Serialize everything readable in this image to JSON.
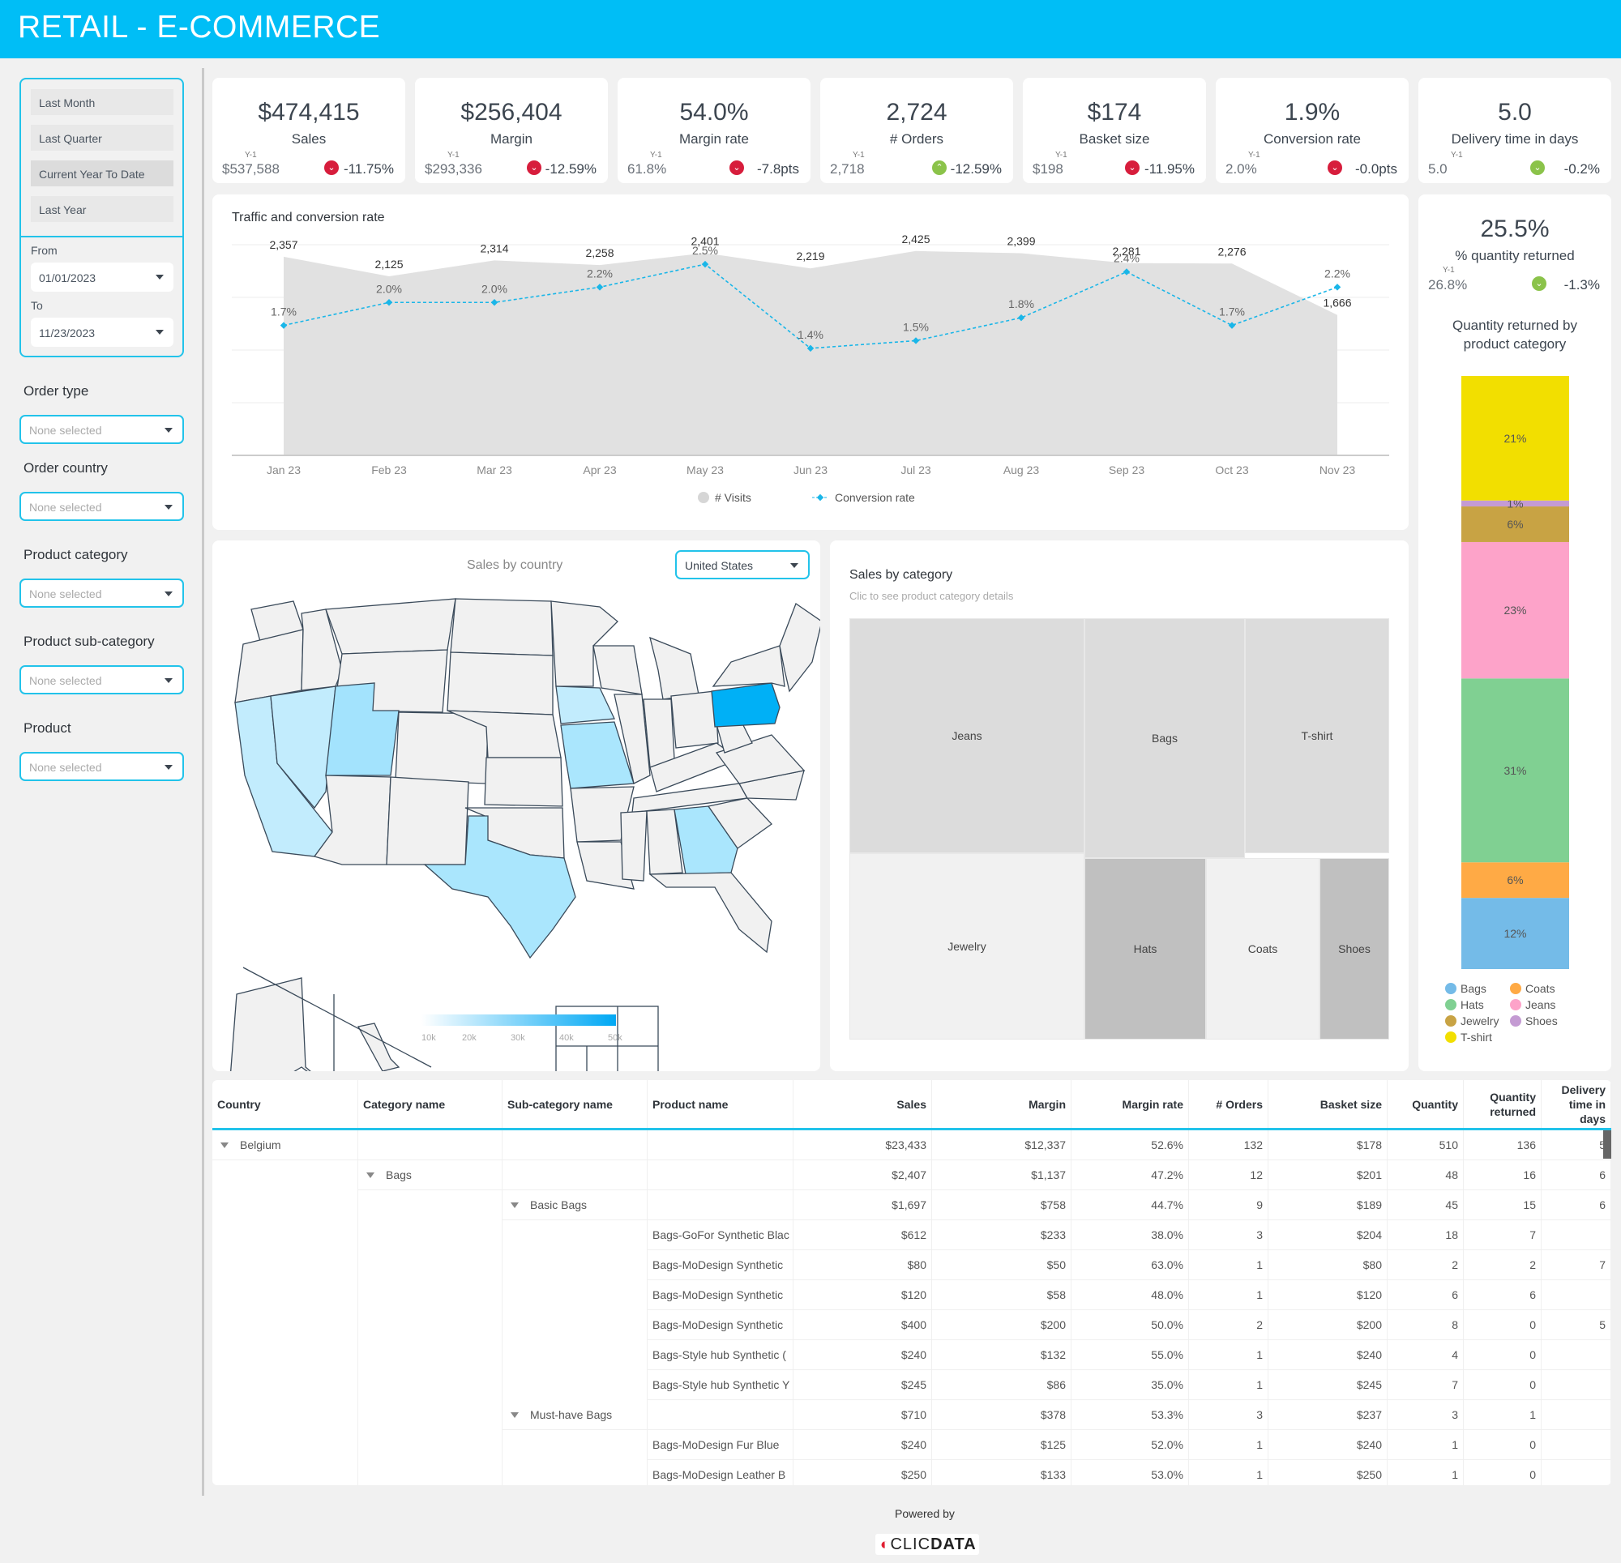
{
  "header": {
    "title": "RETAIL - E-COMMERCE"
  },
  "date_filter": {
    "presets": [
      "Last Month",
      "Last Quarter",
      "Current Year To Date",
      "Last Year"
    ],
    "active_preset": "Current Year To Date",
    "from_label": "From",
    "from_value": "01/01/2023",
    "to_label": "To",
    "to_value": "11/23/2023"
  },
  "filters": [
    {
      "label": "Order type",
      "placeholder": "None selected"
    },
    {
      "label": "Order country",
      "placeholder": "None selected"
    },
    {
      "label": "Product category",
      "placeholder": "None selected"
    },
    {
      "label": "Product sub-category",
      "placeholder": "None selected"
    },
    {
      "label": "Product",
      "placeholder": "None selected"
    }
  ],
  "kpis": [
    {
      "value": "$474,415",
      "name": "Sales",
      "y1_label": "Y-1",
      "prev": "$537,588",
      "delta": "-11.75%",
      "trend": "down",
      "status": "bad"
    },
    {
      "value": "$256,404",
      "name": "Margin",
      "y1_label": "Y-1",
      "prev": "$293,336",
      "delta": "-12.59%",
      "trend": "down",
      "status": "bad"
    },
    {
      "value": "54.0%",
      "name": "Margin rate",
      "y1_label": "Y-1",
      "prev": "61.8%",
      "delta": "-7.8pts",
      "trend": "down",
      "status": "bad"
    },
    {
      "value": "2,724",
      "name": "# Orders",
      "y1_label": "Y-1",
      "prev": "2,718",
      "delta": "-12.59%",
      "trend": "up",
      "status": "good"
    },
    {
      "value": "$174",
      "name": "Basket size",
      "y1_label": "Y-1",
      "prev": "$198",
      "delta": "-11.95%",
      "trend": "down",
      "status": "bad"
    },
    {
      "value": "1.9%",
      "name": "Conversion rate",
      "y1_label": "Y-1",
      "prev": "2.0%",
      "delta": "-0.0pts",
      "trend": "down",
      "status": "bad"
    },
    {
      "value": "5.0",
      "name": "Delivery time in days",
      "y1_label": "Y-1",
      "prev": "5.0",
      "delta": "-0.2%",
      "trend": "down",
      "status": "good"
    }
  ],
  "returns_kpi": {
    "value": "25.5%",
    "name": "% quantity returned",
    "y1_label": "Y-1",
    "prev": "26.8%",
    "delta": "-1.3%",
    "trend": "down",
    "status": "good",
    "chart_title": "Quantity returned by product category"
  },
  "colors": {
    "accent": "#00bef6",
    "bad": "#d71d3c",
    "good": "#8bc34a",
    "line": "#1ab6e8",
    "area": "#e1e1e1"
  },
  "map": {
    "title": "Sales by country",
    "country_select": "United States",
    "legend_ticks": [
      "10k",
      "20k",
      "30k",
      "40k",
      "50k"
    ]
  },
  "treemap": {
    "title": "Sales by category",
    "subtitle": "Clic to see product category details",
    "categories": [
      {
        "name": "Jeans"
      },
      {
        "name": "Bags"
      },
      {
        "name": "T-shirt"
      },
      {
        "name": "Jewelry"
      },
      {
        "name": "Hats"
      },
      {
        "name": "Coats"
      },
      {
        "name": "Shoes"
      }
    ]
  },
  "chart_data": [
    {
      "type": "area",
      "title": "Traffic and conversion rate",
      "categories": [
        "Jan 23",
        "Feb 23",
        "Mar 23",
        "Apr 23",
        "May 23",
        "Jun 23",
        "Jul 23",
        "Aug 23",
        "Sep 23",
        "Oct 23",
        "Nov 23"
      ],
      "series": [
        {
          "name": "# Visits",
          "type": "area",
          "values": [
            2357,
            2125,
            2314,
            2258,
            2401,
            2219,
            2425,
            2399,
            2281,
            2276,
            1666
          ],
          "labels": [
            "2,357",
            "2,125",
            "2,314",
            "2,258",
            "2,401",
            "2,219",
            "2,425",
            "2,399",
            "2,281",
            "2,276",
            "1,666"
          ]
        },
        {
          "name": "Conversion rate",
          "type": "line",
          "values": [
            1.7,
            2.0,
            2.0,
            2.2,
            2.5,
            1.4,
            1.5,
            1.8,
            2.4,
            1.7,
            2.2
          ],
          "labels": [
            "1.7%",
            "2.0%",
            "2.0%",
            "2.2%",
            "2.5%",
            "1.4%",
            "1.5%",
            "1.8%",
            "2.4%",
            "1.7%",
            "2.2%"
          ]
        }
      ],
      "legend": "bottom",
      "grid": true
    },
    {
      "type": "bar",
      "title": "Quantity returned by product category",
      "stacked": true,
      "series": [
        {
          "name": "Bags",
          "value": 12,
          "label": "12%",
          "color": "#74bbe8"
        },
        {
          "name": "Coats",
          "value": 6,
          "label": "6%",
          "color": "#ffaa45"
        },
        {
          "name": "Hats",
          "value": 31,
          "label": "31%",
          "color": "#80d092"
        },
        {
          "name": "Jeans",
          "value": 23,
          "label": "23%",
          "color": "#fda3c9"
        },
        {
          "name": "Jewelry",
          "value": 6,
          "label": "6%",
          "color": "#c8a344"
        },
        {
          "name": "Shoes",
          "value": 1,
          "label": "1%",
          "color": "#c49bd3"
        },
        {
          "name": "T-shirt",
          "value": 21,
          "label": "21%",
          "color": "#f2df00"
        }
      ],
      "legend_order": [
        "Bags",
        "Coats",
        "Hats",
        "Jeans",
        "Jewelry",
        "Shoes",
        "T-shirt"
      ]
    }
  ],
  "table": {
    "columns": [
      "Country",
      "Category name",
      "Sub-category name",
      "Product name",
      "Sales",
      "Margin",
      "Margin rate",
      "# Orders",
      "Basket size",
      "Quantity",
      "Quantity returned",
      "Delivery time in days"
    ],
    "rows": [
      {
        "level": 0,
        "label": "Belgium",
        "values": [
          "$23,433",
          "$12,337",
          "52.6%",
          "132",
          "$178",
          "510",
          "136",
          "5"
        ]
      },
      {
        "level": 1,
        "label": "Bags",
        "values": [
          "$2,407",
          "$1,137",
          "47.2%",
          "12",
          "$201",
          "48",
          "16",
          "6"
        ]
      },
      {
        "level": 2,
        "label": "Basic Bags",
        "values": [
          "$1,697",
          "$758",
          "44.7%",
          "9",
          "$189",
          "45",
          "15",
          "6"
        ]
      },
      {
        "level": 3,
        "label": "Bags-GoFor Synthetic Blac",
        "values": [
          "$612",
          "$233",
          "38.0%",
          "3",
          "$204",
          "18",
          "7",
          ""
        ]
      },
      {
        "level": 3,
        "label": "Bags-MoDesign Synthetic",
        "values": [
          "$80",
          "$50",
          "63.0%",
          "1",
          "$80",
          "2",
          "2",
          "7"
        ]
      },
      {
        "level": 3,
        "label": "Bags-MoDesign Synthetic",
        "values": [
          "$120",
          "$58",
          "48.0%",
          "1",
          "$120",
          "6",
          "6",
          ""
        ]
      },
      {
        "level": 3,
        "label": "Bags-MoDesign Synthetic",
        "values": [
          "$400",
          "$200",
          "50.0%",
          "2",
          "$200",
          "8",
          "0",
          "5"
        ]
      },
      {
        "level": 3,
        "label": "Bags-Style hub Synthetic (",
        "values": [
          "$240",
          "$132",
          "55.0%",
          "1",
          "$240",
          "4",
          "0",
          ""
        ]
      },
      {
        "level": 3,
        "label": "Bags-Style hub Synthetic Y",
        "values": [
          "$245",
          "$86",
          "35.0%",
          "1",
          "$245",
          "7",
          "0",
          ""
        ]
      },
      {
        "level": 2,
        "label": "Must-have Bags",
        "values": [
          "$710",
          "$378",
          "53.3%",
          "3",
          "$237",
          "3",
          "1",
          ""
        ]
      },
      {
        "level": 3,
        "label": "Bags-MoDesign Fur Blue",
        "values": [
          "$240",
          "$125",
          "52.0%",
          "1",
          "$240",
          "1",
          "0",
          ""
        ]
      },
      {
        "level": 3,
        "label": "Bags-MoDesign Leather B",
        "values": [
          "$250",
          "$133",
          "53.0%",
          "1",
          "$250",
          "1",
          "0",
          ""
        ]
      }
    ]
  },
  "footer": {
    "powered_by": "Powered by",
    "brand_left": "CLIC",
    "brand_right": "DATA"
  }
}
